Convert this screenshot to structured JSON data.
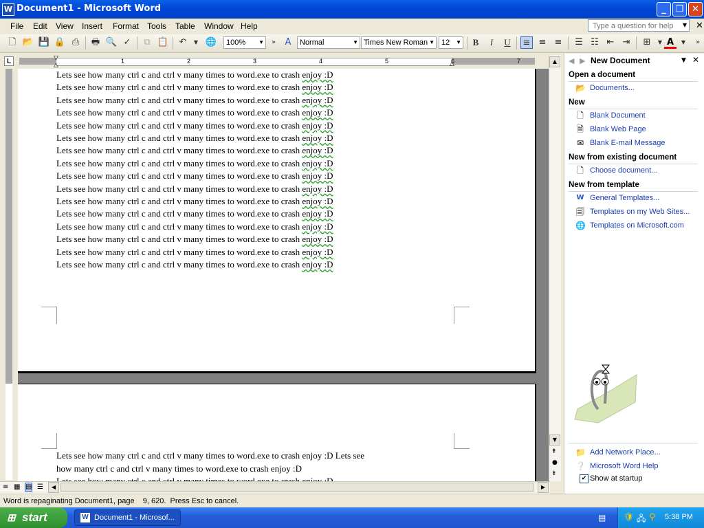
{
  "window": {
    "title": "Document1 - Microsoft Word",
    "app_icon": "W"
  },
  "menu": [
    "File",
    "Edit",
    "View",
    "Insert",
    "Format",
    "Tools",
    "Table",
    "Window",
    "Help"
  ],
  "help_box": {
    "placeholder": "Type a question for help"
  },
  "toolbar": {
    "zoom": "100%",
    "style": "Normal",
    "font": "Times New Roman",
    "size": "12",
    "icons": [
      "new-icon",
      "open-icon",
      "save-icon",
      "permission-icon",
      "print-icon",
      "print-preview-icon",
      "spelling-icon",
      "copy-icon",
      "paste-icon",
      "undo-icon",
      "insert-hyperlink-icon",
      "bold-icon",
      "italic-icon",
      "underline-icon",
      "align-left-icon",
      "center-icon",
      "align-right-icon",
      "numbering-icon",
      "bullets-icon",
      "decrease-indent-icon",
      "increase-indent-icon",
      "borders-icon",
      "font-color-icon"
    ],
    "bold": "B",
    "italic": "I",
    "underline": "U",
    "font_color_glyph": "A"
  },
  "ruler": {
    "numbers": [
      "1",
      "2",
      "3",
      "4",
      "5",
      "6",
      "7"
    ],
    "left_mark": "L"
  },
  "document": {
    "line": "Lets see how many ctrl c and ctrl v many times to word.exe to crash enjoy :D",
    "line_prefix": "Lets see how many ctrl c and ctrl v many times to word.exe to crash ",
    "line_suffix_squiggle": "enjoy :D",
    "page1_line_count": 16,
    "page2_line1": "Lets see how many ctrl c and ctrl v many times to word.exe to crash enjoy :D Lets see",
    "page2_line2": "how many ctrl c and ctrl v many times to word.exe to crash enjoy :D",
    "page2_line3": "Lets see how many ctrl c and ctrl v many times to word.exe to crash enjoy :D"
  },
  "task_pane": {
    "title": "New Document",
    "sections": [
      {
        "heading": "Open a document",
        "links": [
          {
            "label": "Documents...",
            "icon": "folder-icon"
          }
        ]
      },
      {
        "heading": "New",
        "links": [
          {
            "label": "Blank Document",
            "icon": "blank-document-icon"
          },
          {
            "label": "Blank Web Page",
            "icon": "web-page-icon"
          },
          {
            "label": "Blank E-mail Message",
            "icon": "email-icon"
          }
        ]
      },
      {
        "heading": "New from existing document",
        "links": [
          {
            "label": "Choose document...",
            "icon": "document-icon"
          }
        ]
      },
      {
        "heading": "New from template",
        "links": [
          {
            "label": "General Templates...",
            "icon": "templates-icon"
          },
          {
            "label": "Templates on my Web Sites...",
            "icon": "web-templates-icon"
          },
          {
            "label": "Templates on Microsoft.com",
            "icon": "globe-icon"
          }
        ]
      }
    ],
    "footer_links": [
      {
        "label": "Add Network Place...",
        "icon": "network-place-icon"
      },
      {
        "label": "Microsoft Word Help",
        "icon": "help-icon"
      }
    ],
    "show_at_startup": {
      "label": "Show at startup",
      "checked": true
    }
  },
  "status": {
    "text": "Word is repaginating Document1, page    9, 620.  Press Esc to cancel."
  },
  "taskbar": {
    "start": "start",
    "task_button": "Document1 - Microsof...",
    "clock": "5:38 PM"
  }
}
